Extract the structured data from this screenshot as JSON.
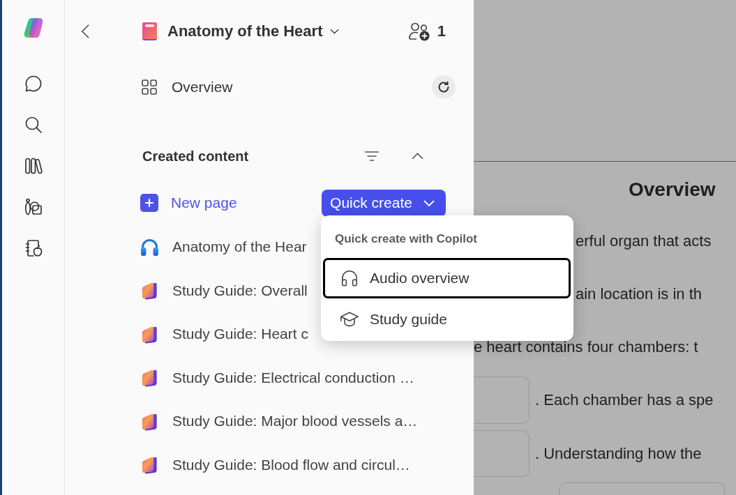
{
  "header": {
    "title": "Anatomy of the Heart",
    "collaborator_count": "1"
  },
  "overview": {
    "label": "Overview"
  },
  "created_content": {
    "heading": "Created content",
    "new_page": "New page",
    "quick_create": "Quick create",
    "items": [
      {
        "kind": "audio",
        "title": "Anatomy of the Hear"
      },
      {
        "kind": "study_guide",
        "title": "Study Guide: Overall"
      },
      {
        "kind": "study_guide",
        "title": "Study Guide: Heart c"
      },
      {
        "kind": "study_guide",
        "title": "Study Guide: Electrical conduction …"
      },
      {
        "kind": "study_guide",
        "title": "Study Guide: Major blood vessels a…"
      },
      {
        "kind": "study_guide",
        "title": "Study Guide: Blood flow and circul…"
      }
    ]
  },
  "quick_create_menu": {
    "heading": "Quick create with Copilot",
    "items": [
      {
        "kind": "audio",
        "label": "Audio overview",
        "focused": true
      },
      {
        "kind": "study_guide",
        "label": "Study guide",
        "focused": false
      }
    ]
  },
  "document": {
    "title": "Overview",
    "lines": [
      {
        "kind": "text",
        "text": "erful organ that acts"
      },
      {
        "kind": "text",
        "text": "ain location is in th"
      },
      {
        "kind": "text",
        "text": "e heart contains four chambers: t"
      },
      {
        "kind": "blank",
        "text": ". Each chamber has a spe"
      },
      {
        "kind": "blank",
        "text": ". Understanding how the"
      },
      {
        "kind": "field"
      }
    ]
  }
}
